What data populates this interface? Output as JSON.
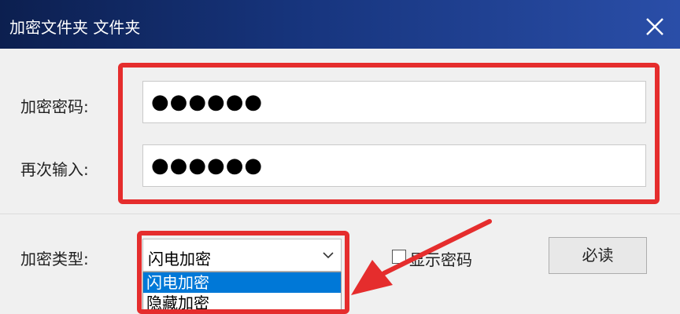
{
  "window": {
    "title": "加密文件夹 文件夹"
  },
  "form": {
    "password_label": "加密密码:",
    "password_value": "●●●●●●",
    "confirm_label": "再次输入:",
    "confirm_value": "●●●●●●",
    "type_label": "加密类型:",
    "type_selected": "闪电加密",
    "type_options": [
      "闪电加密",
      "隐藏加密"
    ],
    "show_password_label": "显示密码",
    "button_label": "必读"
  },
  "icons": {
    "close": "close-icon",
    "dropdown": "chevron-down-icon",
    "annotation": "arrow-annotation"
  },
  "colors": {
    "highlight": "#e52d2d",
    "selection": "#0078d7",
    "titlebar": "#17357e"
  }
}
